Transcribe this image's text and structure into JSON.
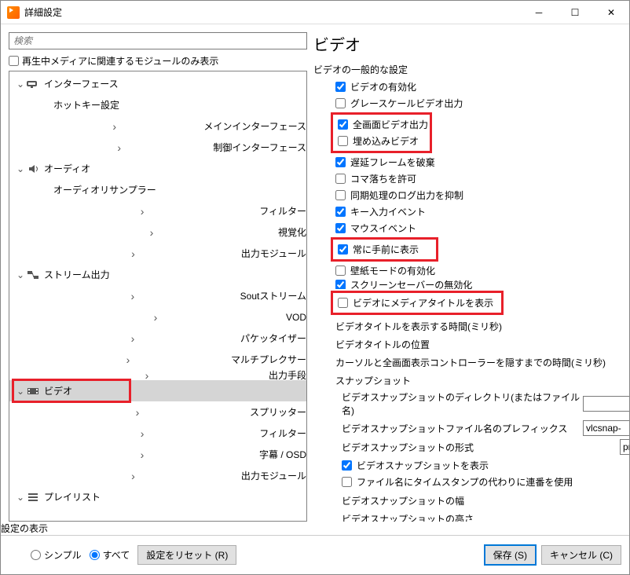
{
  "window": {
    "title": "詳細設定"
  },
  "search": {
    "placeholder": "検索"
  },
  "showOnlyRelated": "再生中メディアに関連するモジュールのみ表示",
  "tree": {
    "interface": {
      "label": "インターフェース",
      "hotkey": "ホットキー設定",
      "main": "メインインターフェース",
      "control": "制御インターフェース"
    },
    "audio": {
      "label": "オーディオ",
      "resampler": "オーディオリサンプラー",
      "filter": "フィルター",
      "visual": "視覚化",
      "output": "出力モジュール"
    },
    "stream": {
      "label": "ストリーム出力",
      "sout": "Soutストリーム",
      "vod": "VOD",
      "packetizer": "パケッタイザー",
      "mux": "マルチプレクサー",
      "access": "出力手段"
    },
    "video": {
      "label": "ビデオ",
      "splitter": "スプリッター",
      "filter": "フィルター",
      "osd": "字幕 / OSD",
      "output": "出力モジュール"
    },
    "playlist": {
      "label": "プレイリスト"
    }
  },
  "right": {
    "title": "ビデオ",
    "group1": "ビデオの一般的な設定",
    "enableVideo": "ビデオの有効化",
    "grayscale": "グレースケールビデオ出力",
    "fullscreen": "全画面ビデオ出力",
    "embedded": "埋め込みビデオ",
    "dropLate": "遅延フレームを破棄",
    "dropFrames": "コマ落ちを許可",
    "quietSync": "同期処理のログ出力を抑制",
    "keyEvents": "キー入力イベント",
    "mouseEvents": "マウスイベント",
    "alwaysOnTop": "常に手前に表示",
    "wallpaper": "壁紙モードの有効化",
    "screensaver": "スクリーンセーバーの無効化",
    "showTitle": "ビデオにメディアタイトルを表示",
    "titleTimeout": "ビデオタイトルを表示する時間(ミリ秒)",
    "titlePos": "ビデオタイトルの位置",
    "hideTimeout": "カーソルと全画面表示コントローラーを隠すまでの時間(ミリ秒)",
    "snapshot": "スナップショット",
    "snapDir": "ビデオスナップショットのディレクトリ(またはファイル名)",
    "snapPrefix": "ビデオスナップショットファイル名のプレフィックス",
    "snapPrefixVal": "vlcsnap-",
    "snapFormat": "ビデオスナップショットの形式",
    "snapFormatVal": "pn",
    "snapPreview": "ビデオスナップショットを表示",
    "snapSeq": "ファイル名にタイムスタンプの代わりに連番を使用",
    "snapWidth": "ビデオスナップショットの幅",
    "snapHeight": "ビデオスナップショットの高さ"
  },
  "footer": {
    "showLabel": "設定の表示",
    "simple": "シンプル",
    "all": "すべて",
    "reset": "設定をリセット (R)",
    "save": "保存 (S)",
    "cancel": "キャンセル (C)"
  }
}
